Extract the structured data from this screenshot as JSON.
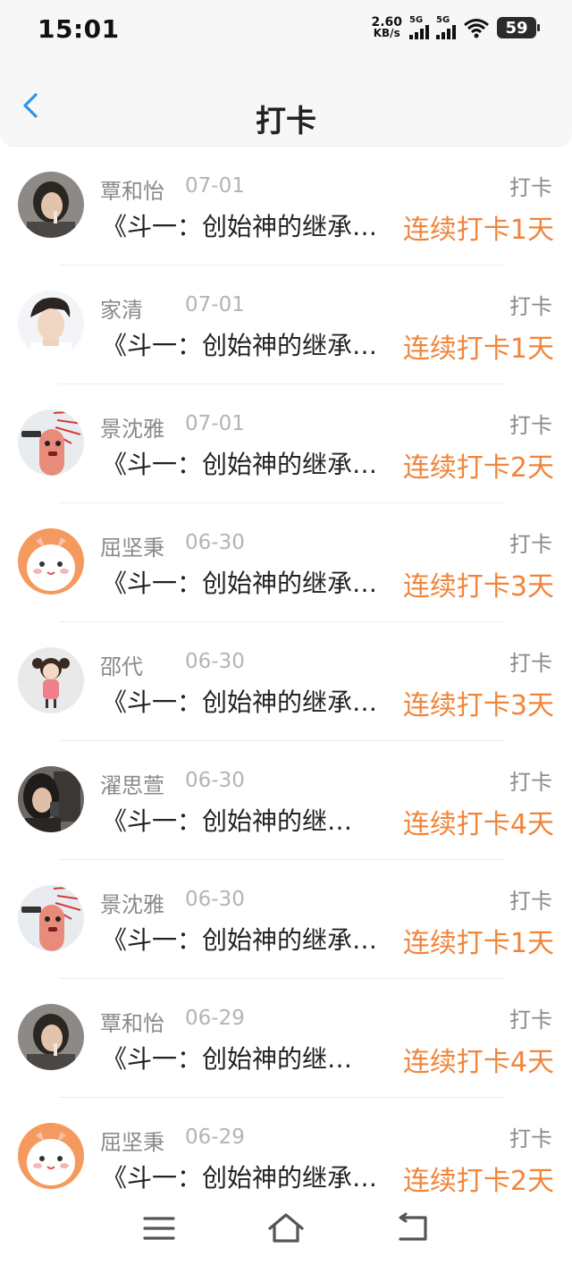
{
  "status": {
    "time": "15:01",
    "speed_value": "2.60",
    "speed_unit": "KB/s",
    "net1": "5G",
    "net2": "5G",
    "battery": "59"
  },
  "header": {
    "title": "打卡"
  },
  "entries": [
    {
      "name": "覃和怡",
      "date": "07-01",
      "tag": "打卡",
      "book": "《斗一：创始神的继承…",
      "streak": "连续打卡1天",
      "avatar": "avatar-girl-dark-hair"
    },
    {
      "name": "家清",
      "date": "07-01",
      "tag": "打卡",
      "book": "《斗一：创始神的继承…",
      "streak": "连续打卡1天",
      "avatar": "avatar-boy-portrait"
    },
    {
      "name": "景沈雅",
      "date": "07-01",
      "tag": "打卡",
      "book": "《斗一：创始神的继承…",
      "streak": "连续打卡2天",
      "avatar": "avatar-finger-cartoon"
    },
    {
      "name": "屈坚秉",
      "date": "06-30",
      "tag": "打卡",
      "book": "《斗一：创始神的继承…",
      "streak": "连续打卡3天",
      "avatar": "avatar-cute-dog"
    },
    {
      "name": "邵代",
      "date": "06-30",
      "tag": "打卡",
      "book": "《斗一：创始神的继承…",
      "streak": "连续打卡3天",
      "avatar": "avatar-cartoon-girl"
    },
    {
      "name": "濯思萱",
      "date": "06-30",
      "tag": "打卡",
      "book": "《斗一：创始神的继…",
      "streak": "连续打卡4天",
      "avatar": "avatar-girl-phone"
    },
    {
      "name": "景沈雅",
      "date": "06-30",
      "tag": "打卡",
      "book": "《斗一：创始神的继承…",
      "streak": "连续打卡1天",
      "avatar": "avatar-finger-cartoon"
    },
    {
      "name": "覃和怡",
      "date": "06-29",
      "tag": "打卡",
      "book": "《斗一：创始神的继…",
      "streak": "连续打卡4天",
      "avatar": "avatar-girl-dark-hair"
    },
    {
      "name": "屈坚秉",
      "date": "06-29",
      "tag": "打卡",
      "book": "《斗一：创始神的继承…",
      "streak": "连续打卡2天",
      "avatar": "avatar-cute-dog"
    }
  ],
  "colors": {
    "accent": "#f0853a",
    "back": "#2f95e8"
  },
  "navbar": {
    "menu_icon": "menu-icon",
    "home_icon": "home-icon",
    "back_icon": "return-icon"
  }
}
